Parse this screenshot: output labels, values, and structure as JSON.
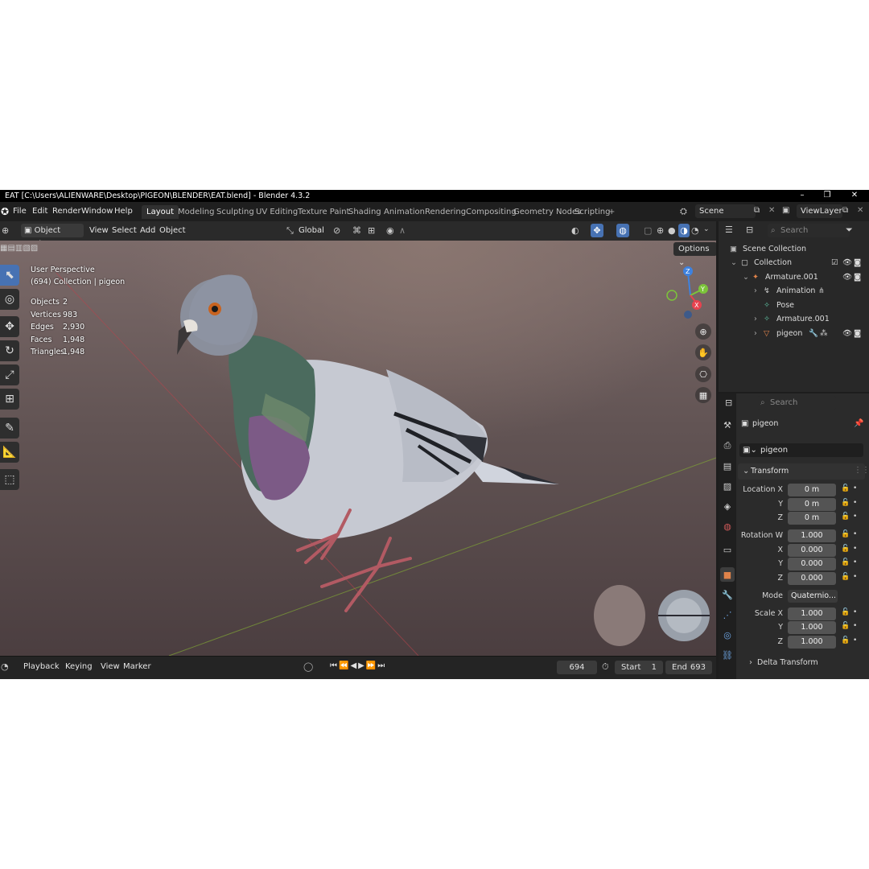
{
  "window": {
    "title": "EAT [C:\\Users\\ALIENWARE\\Desktop\\PIGEON\\BLENDER\\EAT.blend] - Blender 4.3.2",
    "controls": [
      "–",
      "❐",
      "✕"
    ]
  },
  "menu": {
    "items": [
      "File",
      "Edit",
      "Render",
      "Window",
      "Help"
    ],
    "workspaces": [
      "Layout",
      "Modeling",
      "Sculpting",
      "UV Editing",
      "Texture Paint",
      "Shading",
      "Animation",
      "Rendering",
      "Compositing",
      "Geometry Nodes",
      "Scripting"
    ],
    "active_workspace": "Layout",
    "add_tab": "+",
    "scene": "Scene",
    "view_layer": "ViewLayer"
  },
  "viewport_header": {
    "mode": "Object Mode",
    "menus": [
      "View",
      "Select",
      "Add",
      "Object"
    ],
    "orientation": "Global",
    "options": "Options"
  },
  "viewport": {
    "perspective": "User Perspective",
    "collection_line": "(694) Collection | pigeon",
    "stats": [
      {
        "label": "Objects",
        "value": "2"
      },
      {
        "label": "Vertices",
        "value": "983"
      },
      {
        "label": "Edges",
        "value": "2,930"
      },
      {
        "label": "Faces",
        "value": "1,948"
      },
      {
        "label": "Triangles",
        "value": "1,948"
      }
    ],
    "gizmo_axes": [
      "Z",
      "Y",
      "X"
    ]
  },
  "outliner": {
    "search_placeholder": "Search",
    "rows": [
      {
        "label": "Scene Collection"
      },
      {
        "label": "Collection"
      },
      {
        "label": "Armature.001"
      },
      {
        "label": "Animation"
      },
      {
        "label": "Pose"
      },
      {
        "label": "Armature.001"
      },
      {
        "label": "pigeon"
      }
    ]
  },
  "properties": {
    "search_placeholder": "Search",
    "object_name": "pigeon",
    "object_field": "pigeon",
    "transform_title": "Transform",
    "location": [
      {
        "label": "Location X",
        "value": "0 m"
      },
      {
        "label": "Y",
        "value": "0 m"
      },
      {
        "label": "Z",
        "value": "0 m"
      }
    ],
    "rotation": [
      {
        "label": "Rotation W",
        "value": "1.000"
      },
      {
        "label": "X",
        "value": "0.000"
      },
      {
        "label": "Y",
        "value": "0.000"
      },
      {
        "label": "Z",
        "value": "0.000"
      }
    ],
    "mode_label": "Mode",
    "mode_value": "Quaternio...",
    "scale": [
      {
        "label": "Scale X",
        "value": "1.000"
      },
      {
        "label": "Y",
        "value": "1.000"
      },
      {
        "label": "Z",
        "value": "1.000"
      }
    ],
    "delta_transform": "Delta Transform"
  },
  "timeline": {
    "menus": [
      "Playback",
      "Keying",
      "View",
      "Marker"
    ],
    "current_frame": "694",
    "start_label": "Start",
    "start_value": "1",
    "end_label": "End",
    "end_value": "693"
  },
  "colors": {
    "accent": "#4772b3",
    "axis_x": "#e8424f",
    "axis_y": "#7cc43a",
    "axis_z": "#3d82e0"
  }
}
